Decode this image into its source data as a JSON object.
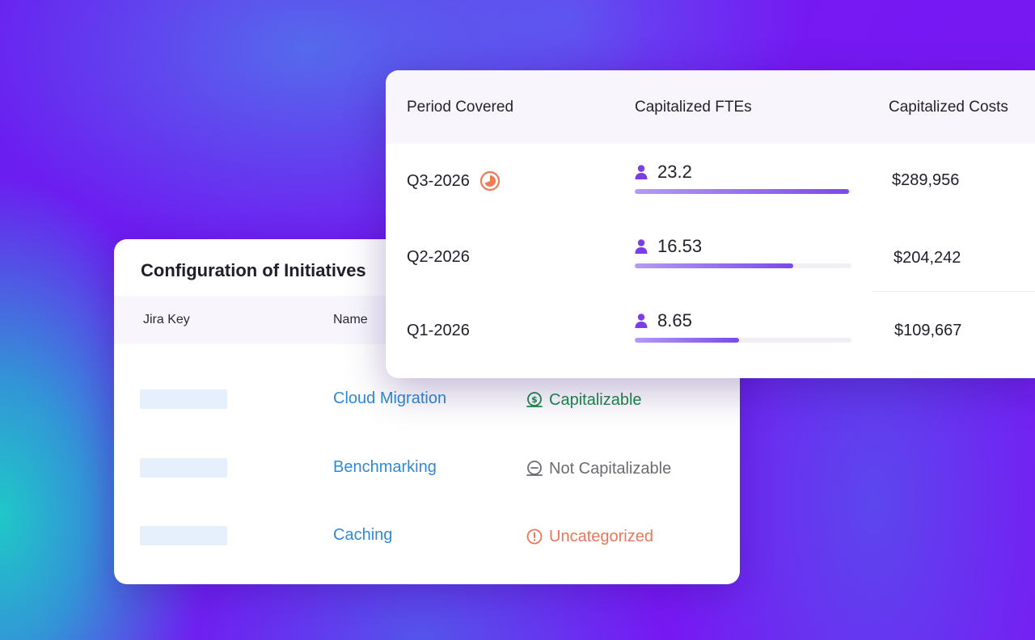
{
  "colors": {
    "link": "#2f8ad6",
    "capitalizable": "#1c8a4a",
    "not_capitalizable": "#6b6b73",
    "uncategorized": "#e8785a",
    "accent": "#7a3ee6"
  },
  "initiatives": {
    "title": "Configuration of Initiatives",
    "columns": {
      "jira_key": "Jira Key",
      "name": "Name"
    },
    "rows": [
      {
        "name": "Cloud Migration",
        "status": "Capitalizable",
        "status_type": "capitalizable",
        "icon": "dollar-icon"
      },
      {
        "name": "Benchmarking",
        "status": "Not Capitalizable",
        "status_type": "not_capitalizable",
        "icon": "minus-circle-icon"
      },
      {
        "name": "Caching",
        "status": "Uncategorized",
        "status_type": "uncategorized",
        "icon": "alert-icon"
      }
    ]
  },
  "periods": {
    "columns": {
      "period": "Period Covered",
      "ftes": "Capitalized FTEs",
      "costs": "Capitalized Costs"
    },
    "rows": [
      {
        "period": "Q3-2026",
        "in_progress": true,
        "ftes": "23.2",
        "fte_fill": 0.99,
        "cost": "$289,956"
      },
      {
        "period": "Q2-2026",
        "in_progress": false,
        "ftes": "16.53",
        "fte_fill": 0.73,
        "cost": "$204,242"
      },
      {
        "period": "Q1-2026",
        "in_progress": false,
        "ftes": "8.65",
        "fte_fill": 0.48,
        "cost": "$109,667"
      }
    ]
  }
}
